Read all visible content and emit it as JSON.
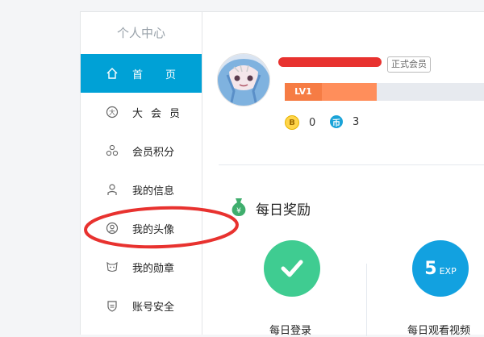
{
  "sidebar": {
    "title": "个人中心",
    "items": [
      {
        "label": "首页",
        "icon": "home-icon",
        "active": true
      },
      {
        "label": "大会员",
        "icon": "vip-icon"
      },
      {
        "label": "会员积分",
        "icon": "points-icon"
      },
      {
        "label": "我的信息",
        "icon": "user-icon"
      },
      {
        "label": "我的头像",
        "icon": "avatar-icon"
      },
      {
        "label": "我的勋章",
        "icon": "medal-icon"
      },
      {
        "label": "账号安全",
        "icon": "shield-icon"
      }
    ]
  },
  "profile": {
    "member_badge": "正式会员",
    "level": "LV1",
    "level_progress": 0.46,
    "bcoin": {
      "icon": "B",
      "value": "0"
    },
    "coins": {
      "icon": "币",
      "value": "3"
    }
  },
  "rewards": {
    "title": "每日奖励",
    "tasks": [
      {
        "label": "每日登录",
        "icon": "check-icon"
      },
      {
        "label": "每日观看视频",
        "exp_value": "5",
        "exp_unit": "EXP"
      }
    ]
  },
  "colors": {
    "accent": "#00a1d6",
    "level": "#ff8e5b",
    "reward_green": "#3fcc91",
    "annotation_red": "#e8322f"
  }
}
